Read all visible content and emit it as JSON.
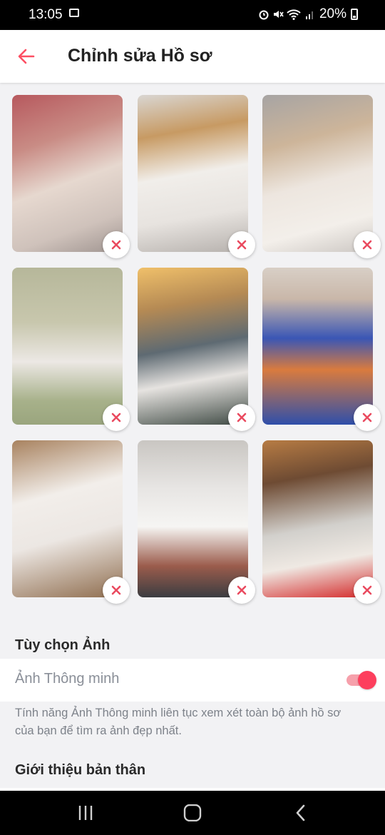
{
  "status_bar": {
    "time": "13:05",
    "battery": "20%"
  },
  "header": {
    "title": "Chỉnh sửa Hồ sơ"
  },
  "photos": [
    {
      "label": "photo-1"
    },
    {
      "label": "photo-2"
    },
    {
      "label": "photo-3"
    },
    {
      "label": "photo-4"
    },
    {
      "label": "photo-5"
    },
    {
      "label": "photo-6"
    },
    {
      "label": "photo-7"
    },
    {
      "label": "photo-8"
    },
    {
      "label": "photo-9"
    }
  ],
  "photo_options": {
    "section_title": "Tùy chọn Ảnh",
    "smart_photos_label": "Ảnh Thông minh",
    "smart_photos_enabled": true,
    "description": "Tính năng Ảnh Thông minh liên tục xem xét toàn bộ ảnh hồ sơ của bạn để tìm ra ảnh đẹp nhất."
  },
  "about": {
    "section_title": "Giới thiệu bản thân"
  },
  "colors": {
    "accent": "#fd3f5d",
    "remove_x": "#ea4a5f",
    "background": "#f2f2f4"
  }
}
